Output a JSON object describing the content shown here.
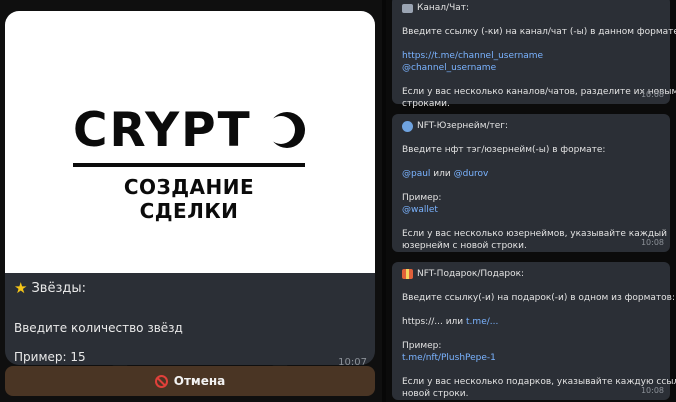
{
  "left": {
    "banner": {
      "logo_text": "CRYPT",
      "logo_subtitle": "СОЗДАНИЕ СДЕЛКИ"
    },
    "card": {
      "title": "Звёзды:",
      "prompt": "Введите количество звёзд",
      "example": "Пример: 15",
      "time": "10:07"
    },
    "cancel_button": {
      "label": "Отмена"
    }
  },
  "right": {
    "bubble1": {
      "title": "Канал/Чат:",
      "line1": "Введите ссылку (-ки) на канал/чат (-ы) в данном формате:",
      "link1": "https://t.me/channel_username",
      "link2": "@channel_username",
      "note1": "Если у вас несколько каналов/чатов, разделите их новыми",
      "note2": "строками.",
      "time": "10:08"
    },
    "bubble2": {
      "title": "NFT-Юзернейм/тег:",
      "line1": "Введите нфт тэг/юзернейм(-ы) в формате:",
      "ex_a": "@paul",
      "ex_or": " или ",
      "ex_b": "@durov",
      "example_label": "Пример:",
      "example_value": "@wallet",
      "note1": "Если у вас несколько юзернеймов, указывайте каждый",
      "note2": "юзернейм с новой строки.",
      "time": "10:08"
    },
    "bubble3": {
      "title": "NFT-Подарок/Подарок:",
      "line1": "Введите ссылку(-и) на подарок(-и) в одном из форматов:",
      "fmt_a": "https://...",
      "fmt_or": " или ",
      "fmt_b": "t.me/...",
      "example_label": "Пример:",
      "example_value": "t.me/nft/PlushPepe-1",
      "note1": "Если у вас несколько подарков, указывайте каждую ссылку с",
      "note2": "новой строки.",
      "time": "10:08"
    }
  }
}
